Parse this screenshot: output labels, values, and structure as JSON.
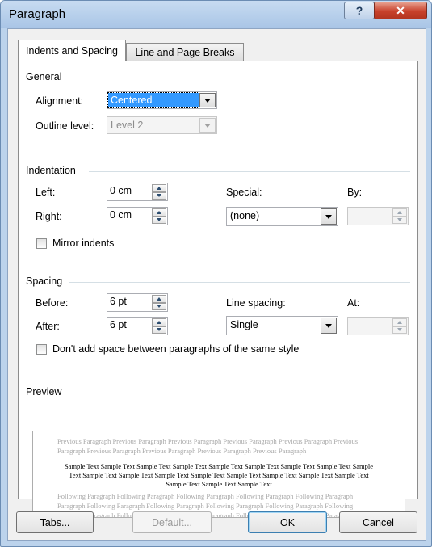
{
  "window": {
    "title": "Paragraph",
    "help_glyph": "?",
    "close_glyph": "✕"
  },
  "tabs": [
    {
      "label": "Indents and Spacing",
      "active": true
    },
    {
      "label": "Line and Page Breaks",
      "active": false
    }
  ],
  "general": {
    "title": "General",
    "alignment": {
      "label": "Alignment:",
      "value": "Centered"
    },
    "outline_level": {
      "label": "Outline level:",
      "value": "Level 2",
      "disabled": true
    }
  },
  "indentation": {
    "title": "Indentation",
    "left": {
      "label": "Left:",
      "value": "0 cm"
    },
    "right": {
      "label": "Right:",
      "value": "0 cm"
    },
    "special": {
      "label": "Special:",
      "value": "(none)"
    },
    "by": {
      "label": "By:",
      "value": ""
    },
    "mirror": {
      "label": "Mirror indents",
      "checked": false
    }
  },
  "spacing": {
    "title": "Spacing",
    "before": {
      "label": "Before:",
      "value": "6 pt"
    },
    "after": {
      "label": "After:",
      "value": "6 pt"
    },
    "line_spacing": {
      "label": "Line spacing:",
      "value": "Single"
    },
    "at": {
      "label": "At:",
      "value": ""
    },
    "dont_add": {
      "label": "Don't add space between paragraphs of the same style",
      "checked": false
    }
  },
  "preview": {
    "title": "Preview",
    "previous": [
      "Previous Paragraph Previous Paragraph Previous Paragraph Previous Paragraph Previous Paragraph Previous",
      "Paragraph Previous Paragraph Previous Paragraph Previous Paragraph Previous Paragraph"
    ],
    "sample": [
      "Sample Text Sample Text Sample Text Sample Text Sample Text Sample Text Sample Text Sample Text Sample",
      "Text Sample Text Sample Text Sample Text Sample Text Sample Text Sample Text Sample Text Sample Text",
      "Sample Text Sample Text Sample Text"
    ],
    "following": [
      "Following Paragraph Following Paragraph Following Paragraph Following Paragraph Following Paragraph",
      "Paragraph Following Paragraph Following Paragraph Following Paragraph Following Paragraph Following",
      "Following Paragraph Following Paragraph Following Paragraph Following Paragraph Following Paragraph"
    ]
  },
  "buttons": {
    "tabs": "Tabs...",
    "default": "Default...",
    "ok": "OK",
    "cancel": "Cancel"
  },
  "colors": {
    "title_bar": "#bcd3ec",
    "selection": "#3399ff",
    "close_button": "#c8412b"
  }
}
